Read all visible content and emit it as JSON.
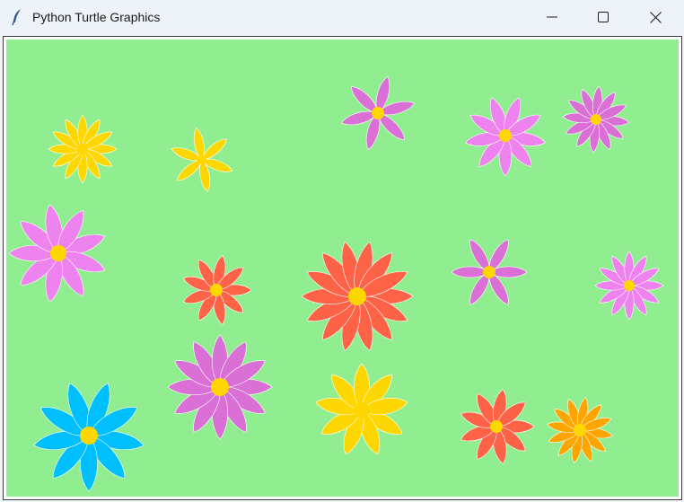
{
  "window": {
    "title": "Python Turtle Graphics",
    "app_icon": "feather-icon",
    "controls": {
      "minimize": "minimize-icon",
      "maximize": "maximize-icon",
      "close": "close-icon"
    }
  },
  "canvas": {
    "background": "#90ee90"
  },
  "colors": {
    "gold": "#ffd700",
    "violet": "#ee82ee",
    "orchid": "#da70d6",
    "tomato": "#ff6347",
    "deepskyblue": "#00bfff",
    "orange": "#ffa500",
    "center": "#ffd700",
    "outline": "#ffffff"
  }
}
